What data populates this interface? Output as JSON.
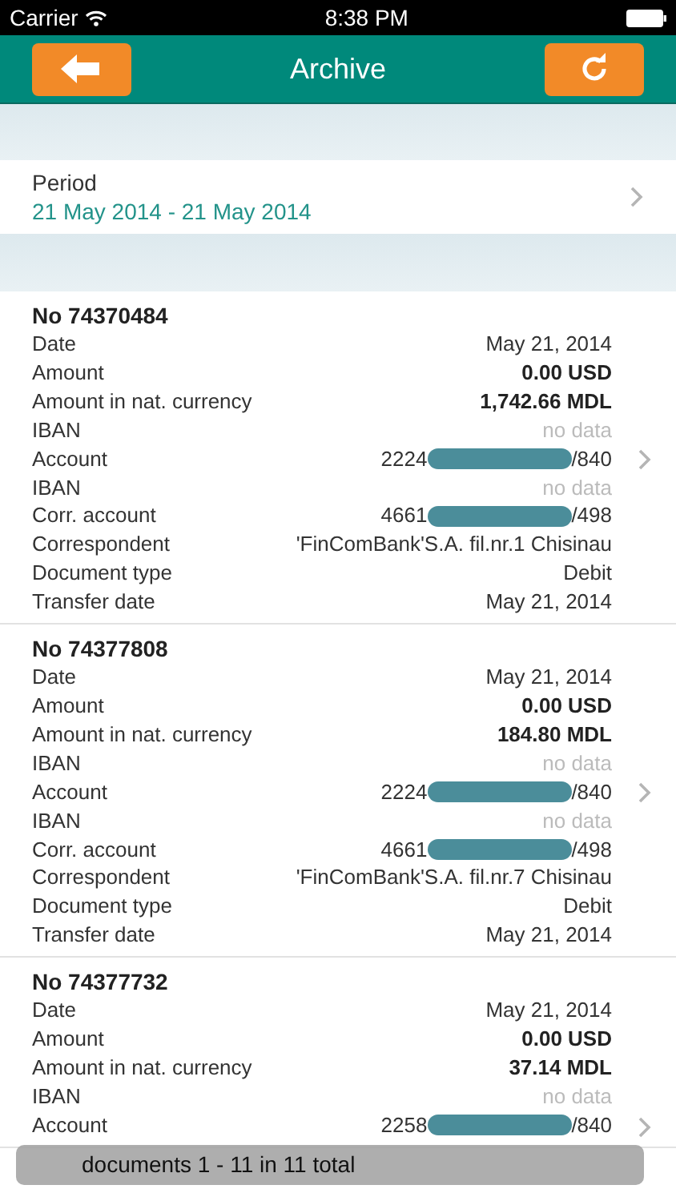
{
  "status_bar": {
    "carrier": "Carrier",
    "time": "8:38 PM"
  },
  "nav": {
    "title": "Archive"
  },
  "period": {
    "label": "Period",
    "value": "21 May 2014 - 21 May 2014"
  },
  "documents": [
    {
      "number": "No 74370484",
      "rows": [
        {
          "label": "Date",
          "kind": "plain",
          "value": "May 21, 2014"
        },
        {
          "label": "Amount",
          "kind": "bold",
          "value": "0.00 USD"
        },
        {
          "label": "Amount in nat. currency",
          "kind": "bold",
          "value": "1,742.66 MDL"
        },
        {
          "label": "IBAN",
          "kind": "muted",
          "value": "no data"
        },
        {
          "label": "Account",
          "kind": "masked",
          "prefix": "2224",
          "suffix": "/840"
        },
        {
          "label": "IBAN",
          "kind": "muted",
          "value": "no data"
        },
        {
          "label": "Corr. account",
          "kind": "masked",
          "prefix": "4661",
          "suffix": "/498"
        },
        {
          "label": "Correspondent",
          "kind": "plain",
          "value": "'FinComBank'S.A. fil.nr.1 Chisinau"
        },
        {
          "label": "Document type",
          "kind": "plain",
          "value": "Debit"
        },
        {
          "label": "Transfer date",
          "kind": "plain",
          "value": "May 21, 2014"
        }
      ]
    },
    {
      "number": "No 74377808",
      "rows": [
        {
          "label": "Date",
          "kind": "plain",
          "value": "May 21, 2014"
        },
        {
          "label": "Amount",
          "kind": "bold",
          "value": "0.00 USD"
        },
        {
          "label": "Amount in nat. currency",
          "kind": "bold",
          "value": "184.80 MDL"
        },
        {
          "label": "IBAN",
          "kind": "muted",
          "value": "no data"
        },
        {
          "label": "Account",
          "kind": "masked",
          "prefix": "2224",
          "suffix": "/840"
        },
        {
          "label": "IBAN",
          "kind": "muted",
          "value": "no data"
        },
        {
          "label": "Corr. account",
          "kind": "masked",
          "prefix": "4661",
          "suffix": "/498"
        },
        {
          "label": "Correspondent",
          "kind": "plain",
          "value": "'FinComBank'S.A. fil.nr.7 Chisinau"
        },
        {
          "label": "Document type",
          "kind": "plain",
          "value": "Debit"
        },
        {
          "label": "Transfer date",
          "kind": "plain",
          "value": "May 21, 2014"
        }
      ]
    },
    {
      "number": "No 74377732",
      "rows": [
        {
          "label": "Date",
          "kind": "plain",
          "value": "May 21, 2014"
        },
        {
          "label": "Amount",
          "kind": "bold",
          "value": "0.00 USD"
        },
        {
          "label": "Amount in nat. currency",
          "kind": "bold",
          "value": "37.14 MDL"
        },
        {
          "label": "IBAN",
          "kind": "muted",
          "value": "no data"
        },
        {
          "label": "Account",
          "kind": "masked",
          "prefix": "2258",
          "suffix": "/840"
        }
      ]
    }
  ],
  "toast": "documents 1 - 11 in 11 total"
}
